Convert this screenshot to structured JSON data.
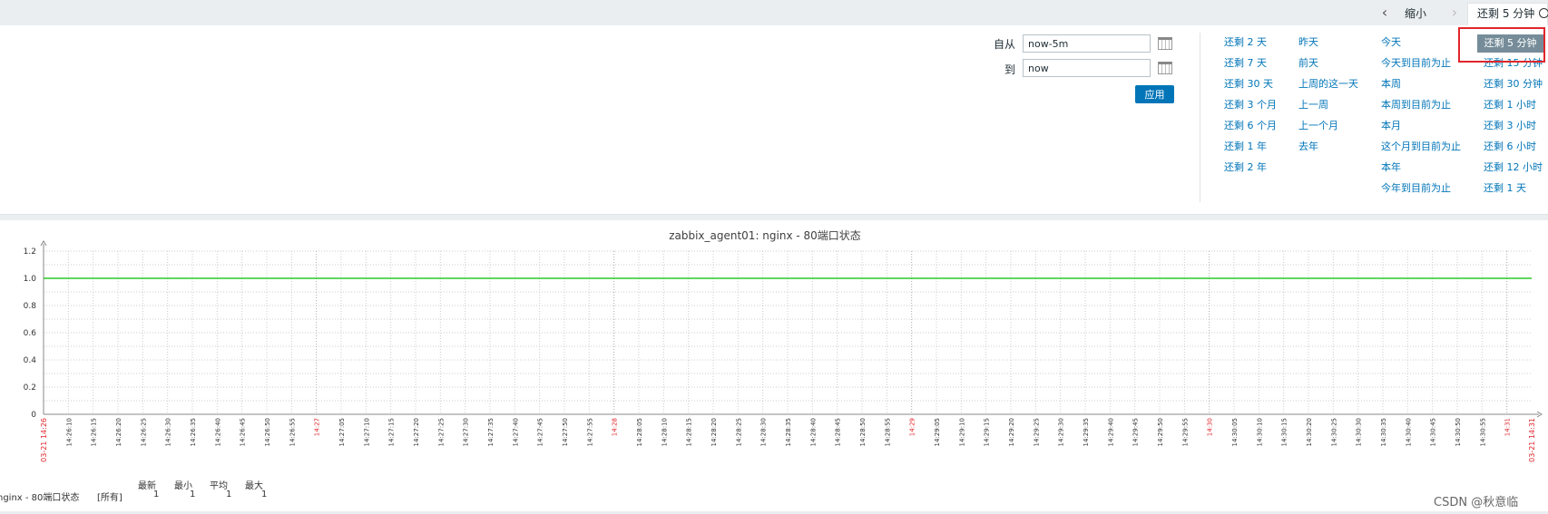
{
  "nav": {
    "zoom_out": "缩小",
    "tab_label": "还剩 5 分钟",
    "prev_arrow": "‹",
    "next_arrow": "›"
  },
  "filter": {
    "from_label": "自从",
    "from_value": "now-5m",
    "to_label": "到",
    "to_value": "now",
    "apply": "应用",
    "selected": "还剩 5 分钟",
    "col1": [
      "还剩 2 天",
      "还剩 7 天",
      "还剩 30 天",
      "还剩 3 个月",
      "还剩 6 个月",
      "还剩 1 年",
      "还剩 2 年"
    ],
    "col2": [
      "昨天",
      "前天",
      "上周的这一天",
      "上一周",
      "上一个月",
      "去年"
    ],
    "col3": [
      "今天",
      "今天到目前为止",
      "本周",
      "本周到目前为止",
      "本月",
      "这个月到目前为止",
      "本年",
      "今年到目前为止"
    ],
    "col4": [
      "还剩 15 分钟",
      "还剩 30 分钟",
      "还剩 1 小时",
      "还剩 3 小时",
      "还剩 6 小时",
      "还剩 12 小时",
      "还剩 1 天"
    ]
  },
  "chart_data": {
    "type": "line",
    "title": "zabbix_agent01: nginx - 80端口状态",
    "ylim": [
      0,
      1.2
    ],
    "y_ticks": [
      "0",
      "0.2",
      "0.4",
      "0.6",
      "0.8",
      "1.0",
      "1.2"
    ],
    "x_start_label": "03-21 14:26",
    "x_end_label": "03-21 14:31",
    "x_ticks": [
      "14:26:10",
      "14:26:15",
      "14:26:20",
      "14:26:25",
      "14:26:30",
      "14:26:35",
      "14:26:40",
      "14:26:45",
      "14:26:50",
      "14:26:55",
      "14:27",
      "14:27:05",
      "14:27:10",
      "14:27:15",
      "14:27:20",
      "14:27:25",
      "14:27:30",
      "14:27:35",
      "14:27:40",
      "14:27:45",
      "14:27:50",
      "14:27:55",
      "14:28",
      "14:28:05",
      "14:28:10",
      "14:28:15",
      "14:28:20",
      "14:28:25",
      "14:28:30",
      "14:28:35",
      "14:28:40",
      "14:28:45",
      "14:28:50",
      "14:28:55",
      "14:29",
      "14:29:05",
      "14:29:10",
      "14:29:15",
      "14:29:20",
      "14:29:25",
      "14:29:30",
      "14:29:35",
      "14:29:40",
      "14:29:45",
      "14:29:50",
      "14:29:55",
      "14:30",
      "14:30:05",
      "14:30:10",
      "14:30:15",
      "14:30:20",
      "14:30:25",
      "14:30:30",
      "14:30:35",
      "14:30:40",
      "14:30:45",
      "14:30:50",
      "14:30:55",
      "14:31"
    ],
    "major_ticks": [
      "14:27",
      "14:28",
      "14:29",
      "14:30",
      "14:31"
    ],
    "series": [
      {
        "name": "nginx - 80端口状态",
        "color": "#00c000",
        "values": [
          1,
          1
        ]
      }
    ],
    "grid": true
  },
  "legend": {
    "item": "nginx - 80端口状态",
    "scope": "[所有]",
    "h_last": "最新",
    "h_min": "最小",
    "h_avg": "平均",
    "h_max": "最大",
    "last": "1",
    "min": "1",
    "avg": "1",
    "max": "1"
  },
  "watermark": "CSDN @秋意临",
  "colors": {
    "link": "#0275b8",
    "series": "#00c000",
    "major_tick": "#e0262b",
    "highlight": "#e0262b"
  }
}
